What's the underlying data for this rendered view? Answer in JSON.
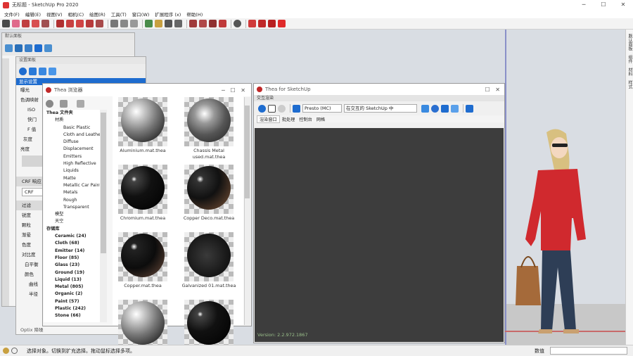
{
  "window": {
    "title": "无标题 - SketchUp Pro 2020",
    "minimize": "─",
    "maximize": "☐",
    "close": "✕"
  },
  "menu": [
    "文件(F)",
    "编辑(E)",
    "视图(V)",
    "相机(C)",
    "绘图(R)",
    "工具(T)",
    "窗口(W)",
    "扩展程序 (x)",
    "帮助(H)"
  ],
  "default_tray": {
    "title": "默认面板"
  },
  "settings_panel": {
    "title": "设置面板",
    "rows": [
      "显示设置",
      "曝光",
      "色调映射",
      "ISO",
      "快门",
      "F 值",
      "灰度",
      "亮度",
      "CRF 响应",
      "CRF",
      "过滤",
      "锐度",
      "颗粒",
      "渐晕",
      "色度",
      "对比度",
      "白平衡",
      "颜色",
      "曲线",
      "半径",
      "Optix 降噪"
    ]
  },
  "browser": {
    "title": "Thea 浏览器",
    "tree": [
      {
        "t": "Thea 文件夹",
        "b": true,
        "lvl": 0
      },
      {
        "t": "材质",
        "b": false,
        "lvl": 1
      },
      {
        "t": "Basic Plastic",
        "b": false,
        "lvl": 2
      },
      {
        "t": "Cloth and Leather",
        "b": false,
        "lvl": 2
      },
      {
        "t": "Diffuse",
        "b": false,
        "lvl": 2
      },
      {
        "t": "Displacement",
        "b": false,
        "lvl": 2
      },
      {
        "t": "Emitters",
        "b": false,
        "lvl": 2
      },
      {
        "t": "High Reflective",
        "b": false,
        "lvl": 2
      },
      {
        "t": "Liquids",
        "b": false,
        "lvl": 2
      },
      {
        "t": "Matte",
        "b": false,
        "lvl": 2
      },
      {
        "t": "Metallic Car Paint",
        "b": false,
        "lvl": 2
      },
      {
        "t": "Metals",
        "b": false,
        "lvl": 2
      },
      {
        "t": "Rough",
        "b": false,
        "lvl": 2
      },
      {
        "t": "Transparent",
        "b": false,
        "lvl": 2
      },
      {
        "t": "模型",
        "b": false,
        "lvl": 1
      },
      {
        "t": "天空",
        "b": false,
        "lvl": 1
      },
      {
        "t": "存储库",
        "b": true,
        "lvl": 0
      },
      {
        "t": "Ceramic (24)",
        "b": true,
        "lvl": 1
      },
      {
        "t": "Cloth (68)",
        "b": true,
        "lvl": 1
      },
      {
        "t": "Emitter (14)",
        "b": true,
        "lvl": 1
      },
      {
        "t": "Floor (85)",
        "b": true,
        "lvl": 1
      },
      {
        "t": "Glass (23)",
        "b": true,
        "lvl": 1
      },
      {
        "t": "Ground (19)",
        "b": true,
        "lvl": 1
      },
      {
        "t": "Liquid (13)",
        "b": true,
        "lvl": 1
      },
      {
        "t": "Metal (805)",
        "b": true,
        "lvl": 1
      },
      {
        "t": "Organic (2)",
        "b": true,
        "lvl": 1
      },
      {
        "t": "Paint (57)",
        "b": true,
        "lvl": 1
      },
      {
        "t": "Plastic (242)",
        "b": true,
        "lvl": 1
      },
      {
        "t": "Stone (66)",
        "b": true,
        "lvl": 1
      }
    ],
    "materials": [
      {
        "name": "Aluminium.mat.thea",
        "name2": "",
        "style": "silver"
      },
      {
        "name": "Chassis Metal",
        "name2": "used.mat.thea",
        "style": "chrome"
      },
      {
        "name": "Chromium.mat.thea",
        "name2": "",
        "style": "dark"
      },
      {
        "name": "Copper Deco.mat.thea",
        "name2": "",
        "style": "copper"
      },
      {
        "name": "Copper.mat.thea",
        "name2": "",
        "style": "copperdark"
      },
      {
        "name": "Galvanized 01.mat.thea",
        "name2": "",
        "style": "galv"
      },
      {
        "name": "",
        "name2": "",
        "style": "silver"
      },
      {
        "name": "",
        "name2": "",
        "style": "dark"
      }
    ]
  },
  "thea": {
    "title": "Thea for SketchUp",
    "subtitle": "交互渲染",
    "preset": "Presto (MC)",
    "target": "在交互的 SketchUp 中",
    "tabs": [
      "渲染窗口",
      "批处理",
      "控制台",
      "网格"
    ],
    "version": "Version: 2.2.972.1867"
  },
  "right_panel": [
    "默认面板",
    "组件",
    "材料",
    "样式"
  ],
  "status": {
    "hint": "选择对象。切换到扩充选择。拖动鼠标选择多项。",
    "measure": "数值"
  },
  "colors": {
    "viewport": "#d9dde3",
    "accent": "#1e6ccf"
  }
}
